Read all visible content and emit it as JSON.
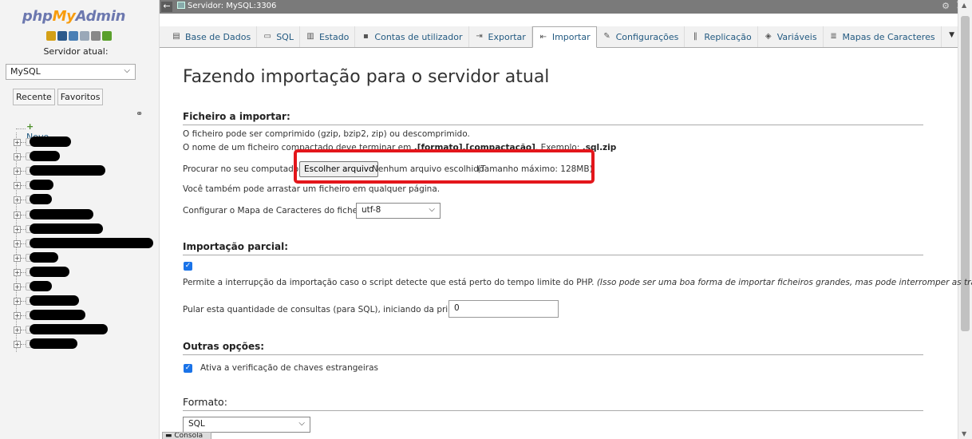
{
  "nav": {
    "logo": {
      "php": "php",
      "my": "My",
      "admin": "Admin"
    },
    "quick_icons": [
      {
        "name": "home-icon",
        "color": "#d4a017"
      },
      {
        "name": "exit-icon",
        "color": "#2c5a8c"
      },
      {
        "name": "help-icon",
        "color": "#4a7fb5"
      },
      {
        "name": "docs-icon",
        "color": "#9aa8b8"
      },
      {
        "name": "settings-icon",
        "color": "#888888"
      },
      {
        "name": "reload-icon",
        "color": "#5aa02c"
      }
    ],
    "server_label": "Servidor atual:",
    "server_select": "MySQL",
    "tabs": [
      "Recente",
      "Favoritos"
    ],
    "tree_new": "Novo",
    "tree_count": 16
  },
  "topbar": {
    "server": "Servidor: MySQL:3306"
  },
  "tabs": [
    {
      "label": "Base de Dados",
      "icon": "▤",
      "name": "tab-databases"
    },
    {
      "label": "SQL",
      "icon": "▭",
      "name": "tab-sql"
    },
    {
      "label": "Estado",
      "icon": "▥",
      "name": "tab-status"
    },
    {
      "label": "Contas de utilizador",
      "icon": "▪",
      "name": "tab-user-accounts"
    },
    {
      "label": "Exportar",
      "icon": "⇥",
      "name": "tab-export"
    },
    {
      "label": "Importar",
      "icon": "⇤",
      "name": "tab-import",
      "active": true
    },
    {
      "label": "Configurações",
      "icon": "✎",
      "name": "tab-settings"
    },
    {
      "label": "Replicação",
      "icon": "‖",
      "name": "tab-replication"
    },
    {
      "label": "Variáveis",
      "icon": "◈",
      "name": "tab-variables"
    },
    {
      "label": "Mapas de Caracteres",
      "icon": "≣",
      "name": "tab-charsets"
    }
  ],
  "main": {
    "title": "Fazendo importação para o servidor atual",
    "file_section": {
      "heading": "Ficheiro a importar:",
      "line1": "O ficheiro pode ser comprimido (gzip, bzip2, zip) ou descomprimido.",
      "line2_prefix": "O nome de um ficheiro compactado deve terminar em ",
      "line2_bold": ".[formato].[compactação]",
      "line2_mid": ". Exemplo: ",
      "line2_example": ".sql.zip",
      "browse_label": "Procurar no seu computador:",
      "choose_button": "Escolher arquivo",
      "no_file": "Nenhum arquivo escolhido",
      "max_size": "(Tamanho máximo: 128MB)",
      "drag_hint": "Você também pode arrastar um ficheiro em qualquer página.",
      "charset_label": "Configurar o Mapa de Caracteres do ficheiro:",
      "charset_value": "utf-8"
    },
    "partial_section": {
      "heading": "Importação parcial:",
      "allow_interrupt": "Permite a interrupção da importação caso o script detecte que está perto do tempo limite do PHP. ",
      "allow_interrupt_note": "(Isso pode ser uma boa forma de importar ficheiros grandes, mas pode interromper as transações.)",
      "skip_label": "Pular esta quantidade de consultas (para SQL), iniciando da primeira:",
      "skip_value": "0"
    },
    "other_section": {
      "heading": "Outras opções:",
      "fk_checks": "Ativa a verificação de chaves estrangeiras"
    },
    "format_section": {
      "heading": "Formato:",
      "format_value": "SQL"
    }
  },
  "console_label": "Consola",
  "colors": {
    "accent": "#235a81",
    "highlight": "#e3161b",
    "checkbox": "#1a73e8"
  }
}
